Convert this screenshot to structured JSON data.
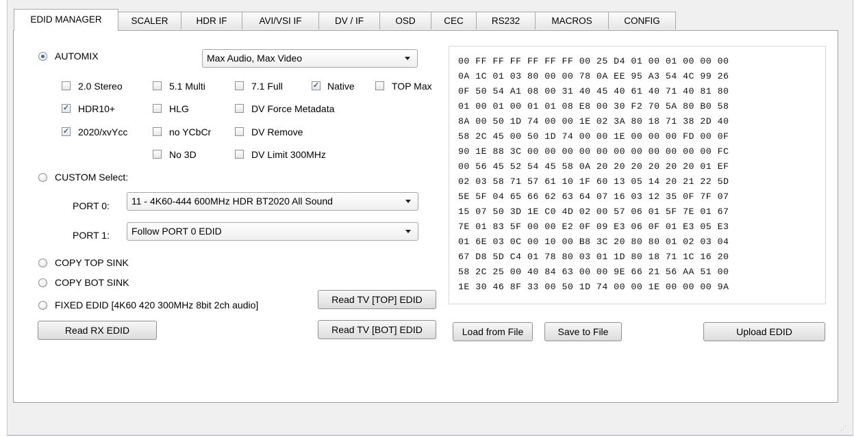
{
  "tabs": [
    "EDID MANAGER",
    "SCALER",
    "HDR IF",
    "AVI/VSI IF",
    "DV / IF",
    "OSD",
    "CEC",
    "RS232",
    "MACROS",
    "CONFIG"
  ],
  "automix": {
    "label": "AUTOMIX",
    "selected": true,
    "combo_value": "Max Audio, Max Video"
  },
  "checkboxes": [
    {
      "label": "2.0 Stereo",
      "checked": false
    },
    {
      "label": "5.1 Multi",
      "checked": false
    },
    {
      "label": "7.1 Full",
      "checked": false
    },
    {
      "label": "Native",
      "checked": true
    },
    {
      "label": "TOP Max",
      "checked": false
    },
    {
      "label": "HDR10+",
      "checked": true
    },
    {
      "label": "HLG",
      "checked": false
    },
    {
      "label": "DV Force Metadata",
      "checked": false
    },
    {
      "label": "2020/xvYcc",
      "checked": true
    },
    {
      "label": "no YCbCr",
      "checked": false
    },
    {
      "label": "DV Remove",
      "checked": false
    },
    {
      "label": "No 3D",
      "checked": false
    },
    {
      "label": "DV Limit 300MHz",
      "checked": false
    }
  ],
  "custom": {
    "label": "CUSTOM Select:",
    "port0_label": "PORT 0:",
    "port0_value": "11 - 4K60-444 600MHz HDR BT2020 All Sound",
    "port1_label": "PORT 1:",
    "port1_value": "Follow PORT 0 EDID"
  },
  "copy_top_sink": "COPY TOP SINK",
  "copy_bot_sink": "COPY BOT SINK",
  "fixed_edid": "FIXED EDID [4K60 420 300MHz 8bit 2ch audio]",
  "buttons": {
    "read_rx": "Read RX  EDID",
    "read_tv_top": "Read TV [TOP] EDID",
    "read_tv_bot": "Read TV [BOT] EDID",
    "load_file": "Load from File",
    "save_file": "Save to File",
    "upload": "Upload EDID"
  },
  "hex_lines": [
    "00 FF FF FF FF FF FF 00 25 D4 01 00 01 00 00 00",
    "0A 1C 01 03 80 00 00 78 0A EE 95 A3 54 4C 99 26",
    "0F 50 54 A1 08 00 31 40 45 40 61 40 71 40 81 80",
    "01 00 01 00 01 01 08 E8 00 30 F2 70 5A 80 B0 58",
    "8A 00 50 1D 74 00 00 1E 02 3A 80 18 71 38 2D 40",
    "58 2C 45 00 50 1D 74 00 00 1E 00 00 00 FD 00 0F",
    "90 1E 88 3C 00 00 00 00 00 00 00 00 00 00 00 FC",
    "00 56 45 52 54 45 58 0A 20 20 20 20 20 20 01 EF",
    "02 03 58 71 57 61 10 1F 60 13 05 14 20 21 22 5D",
    "5E 5F 04 65 66 62 63 64 07 16 03 12 35 0F 7F 07",
    "15 07 50 3D 1E C0 4D 02 00 57 06 01 5F 7E 01 67",
    "7E 01 83 5F 00 00 E2 0F 09 E3 06 0F 01 E3 05 E3",
    "01 6E 03 0C 00 10 00 B8 3C 20 80 80 01 02 03 04",
    "67 D8 5D C4 01 78 80 03 01 1D 80 18 71 1C 16 20",
    "58 2C 25 00 40 84 63 00 00 9E 66 21 56 AA 51 00",
    "1E 30 46 8F 33 00 50 1D 74 00 00 1E 00 00 00 9A"
  ]
}
